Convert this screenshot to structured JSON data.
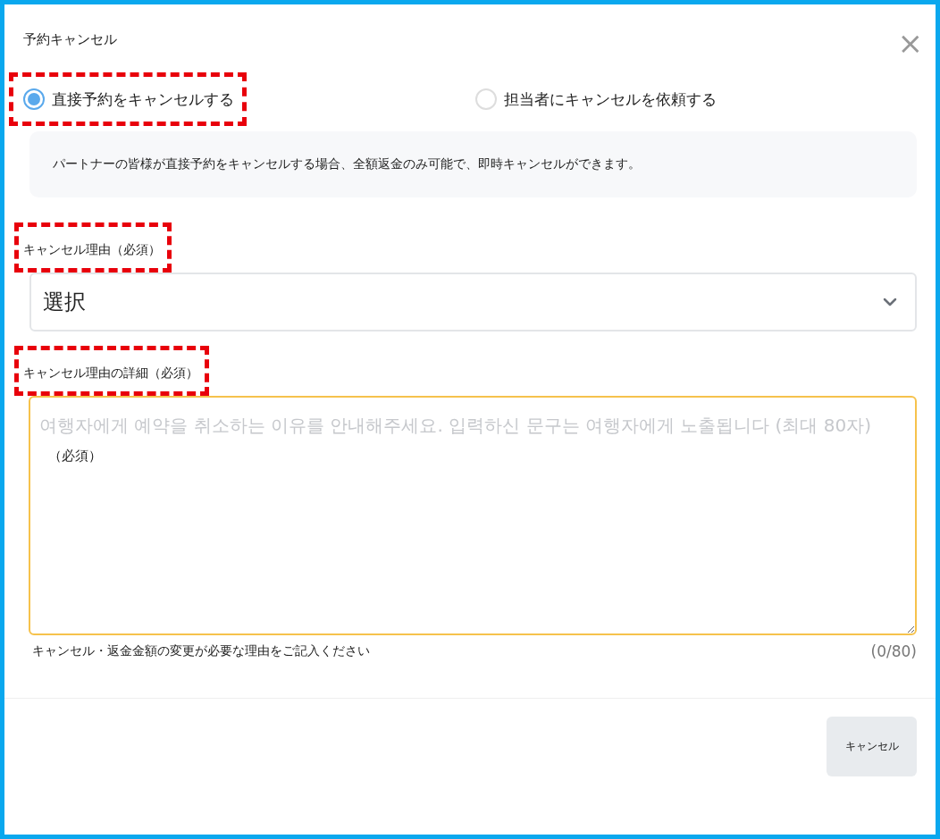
{
  "dialog": {
    "title": "予約キャンセル",
    "close_icon": "×"
  },
  "options": [
    {
      "label": "直接予約をキャンセルする",
      "selected": true,
      "highlighted": true
    },
    {
      "label": "担当者にキャンセルを依頼する",
      "selected": false,
      "highlighted": false
    }
  ],
  "info": "パートナーの皆様が直接予約をキャンセルする場合、全額返金のみ可能で、即時キャンセルができます。",
  "reason": {
    "label": "キャンセル理由（必須）",
    "highlighted": true,
    "value": "選択"
  },
  "detail": {
    "label": "キャンセル理由の詳細（必須）",
    "highlighted": true,
    "placeholder": "여행자에게 예약을 취소하는 이유를 안내해주세요. 입력하신 문구는 여행자에게 노출됩니다 (최대 80자)",
    "note": "（必須）",
    "help": "キャンセル・返金金額の変更が必要な理由をご記入ください",
    "counter": "(0/80)"
  },
  "buttons": [
    {
      "label": "キャンセル"
    }
  ]
}
